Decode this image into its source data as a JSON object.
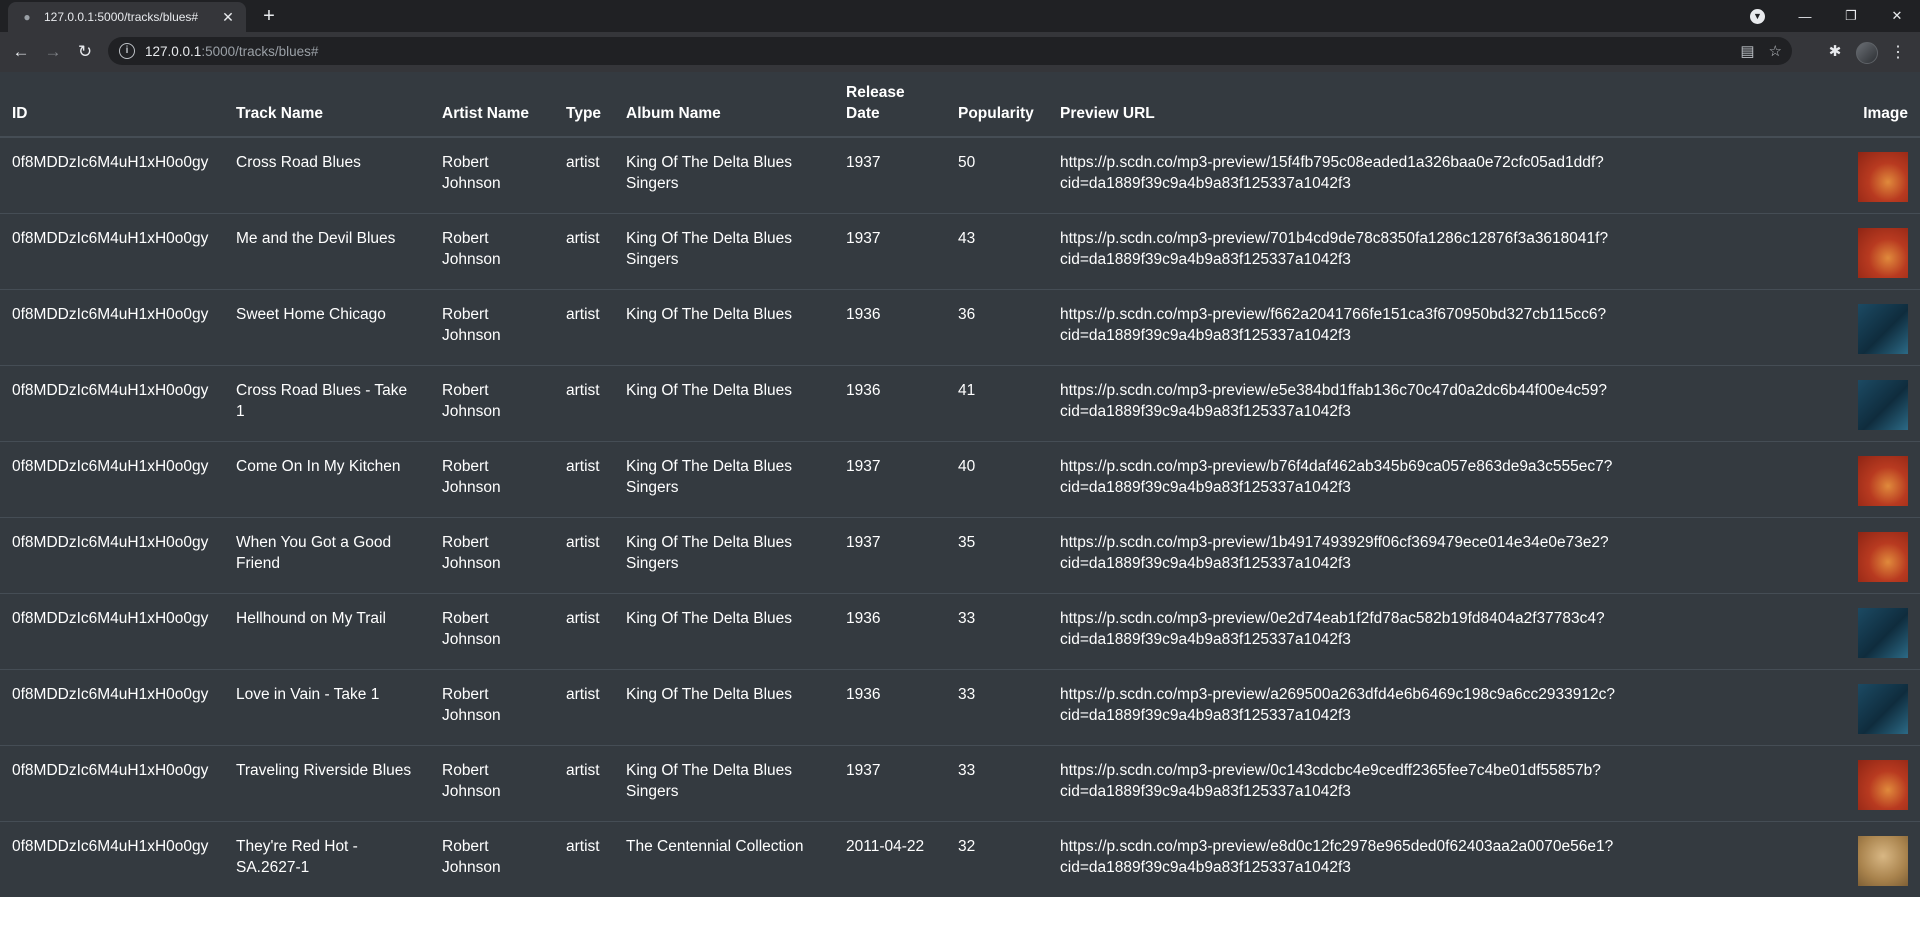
{
  "browser": {
    "tab_title": "127.0.0.1:5000/tracks/blues#",
    "url_host": "127.0.0.1",
    "url_rest": ":5000/tracks/blues#"
  },
  "table": {
    "headers": [
      "ID",
      "Track Name",
      "Artist Name",
      "Type",
      "Album Name",
      "Release Date",
      "Popularity",
      "Preview URL",
      "Image"
    ],
    "rows": [
      {
        "id": "0f8MDDzIc6M4uH1xH0o0gy",
        "track": "Cross Road Blues",
        "artist": "Robert Johnson",
        "type": "artist",
        "album": "King Of The Delta Blues Singers",
        "date": "1937",
        "popularity": "50",
        "preview": "https://p.scdn.co/mp3-preview/15f4fb795c08eaded1a326baa0e72cfc05ad1ddf?cid=da1889f39c9a4b9a83f125337a1042f3",
        "image": "red"
      },
      {
        "id": "0f8MDDzIc6M4uH1xH0o0gy",
        "track": "Me and the Devil Blues",
        "artist": "Robert Johnson",
        "type": "artist",
        "album": "King Of The Delta Blues Singers",
        "date": "1937",
        "popularity": "43",
        "preview": "https://p.scdn.co/mp3-preview/701b4cd9de78c8350fa1286c12876f3a3618041f?cid=da1889f39c9a4b9a83f125337a1042f3",
        "image": "red"
      },
      {
        "id": "0f8MDDzIc6M4uH1xH0o0gy",
        "track": "Sweet Home Chicago",
        "artist": "Robert Johnson",
        "type": "artist",
        "album": "King Of The Delta Blues",
        "date": "1936",
        "popularity": "36",
        "preview": "https://p.scdn.co/mp3-preview/f662a2041766fe151ca3f670950bd327cb115cc6?cid=da1889f39c9a4b9a83f125337a1042f3",
        "image": "blue"
      },
      {
        "id": "0f8MDDzIc6M4uH1xH0o0gy",
        "track": "Cross Road Blues - Take 1",
        "artist": "Robert Johnson",
        "type": "artist",
        "album": "King Of The Delta Blues",
        "date": "1936",
        "popularity": "41",
        "preview": "https://p.scdn.co/mp3-preview/e5e384bd1ffab136c70c47d0a2dc6b44f00e4c59?cid=da1889f39c9a4b9a83f125337a1042f3",
        "image": "blue"
      },
      {
        "id": "0f8MDDzIc6M4uH1xH0o0gy",
        "track": "Come On In My Kitchen",
        "artist": "Robert Johnson",
        "type": "artist",
        "album": "King Of The Delta Blues Singers",
        "date": "1937",
        "popularity": "40",
        "preview": "https://p.scdn.co/mp3-preview/b76f4daf462ab345b69ca057e863de9a3c555ec7?cid=da1889f39c9a4b9a83f125337a1042f3",
        "image": "red"
      },
      {
        "id": "0f8MDDzIc6M4uH1xH0o0gy",
        "track": "When You Got a Good Friend",
        "artist": "Robert Johnson",
        "type": "artist",
        "album": "King Of The Delta Blues Singers",
        "date": "1937",
        "popularity": "35",
        "preview": "https://p.scdn.co/mp3-preview/1b4917493929ff06cf369479ece014e34e0e73e2?cid=da1889f39c9a4b9a83f125337a1042f3",
        "image": "red"
      },
      {
        "id": "0f8MDDzIc6M4uH1xH0o0gy",
        "track": "Hellhound on My Trail",
        "artist": "Robert Johnson",
        "type": "artist",
        "album": "King Of The Delta Blues",
        "date": "1936",
        "popularity": "33",
        "preview": "https://p.scdn.co/mp3-preview/0e2d74eab1f2fd78ac582b19fd8404a2f37783c4?cid=da1889f39c9a4b9a83f125337a1042f3",
        "image": "blue"
      },
      {
        "id": "0f8MDDzIc6M4uH1xH0o0gy",
        "track": "Love in Vain - Take 1",
        "artist": "Robert Johnson",
        "type": "artist",
        "album": "King Of The Delta Blues",
        "date": "1936",
        "popularity": "33",
        "preview": "https://p.scdn.co/mp3-preview/a269500a263dfd4e6b6469c198c9a6cc2933912c?cid=da1889f39c9a4b9a83f125337a1042f3",
        "image": "blue"
      },
      {
        "id": "0f8MDDzIc6M4uH1xH0o0gy",
        "track": "Traveling Riverside Blues",
        "artist": "Robert Johnson",
        "type": "artist",
        "album": "King Of The Delta Blues Singers",
        "date": "1937",
        "popularity": "33",
        "preview": "https://p.scdn.co/mp3-preview/0c143cdcbc4e9cedff2365fee7c4be01df55857b?cid=da1889f39c9a4b9a83f125337a1042f3",
        "image": "red"
      },
      {
        "id": "0f8MDDzIc6M4uH1xH0o0gy",
        "track": "They're Red Hot - SA.2627-1",
        "artist": "Robert Johnson",
        "type": "artist",
        "album": "The Centennial Collection",
        "date": "2011-04-22",
        "popularity": "32",
        "preview": "https://p.scdn.co/mp3-preview/e8d0c12fc2978e965ded0f62403aa2a0070e56e1?cid=da1889f39c9a4b9a83f125337a1042f3",
        "image": "tan"
      }
    ]
  }
}
